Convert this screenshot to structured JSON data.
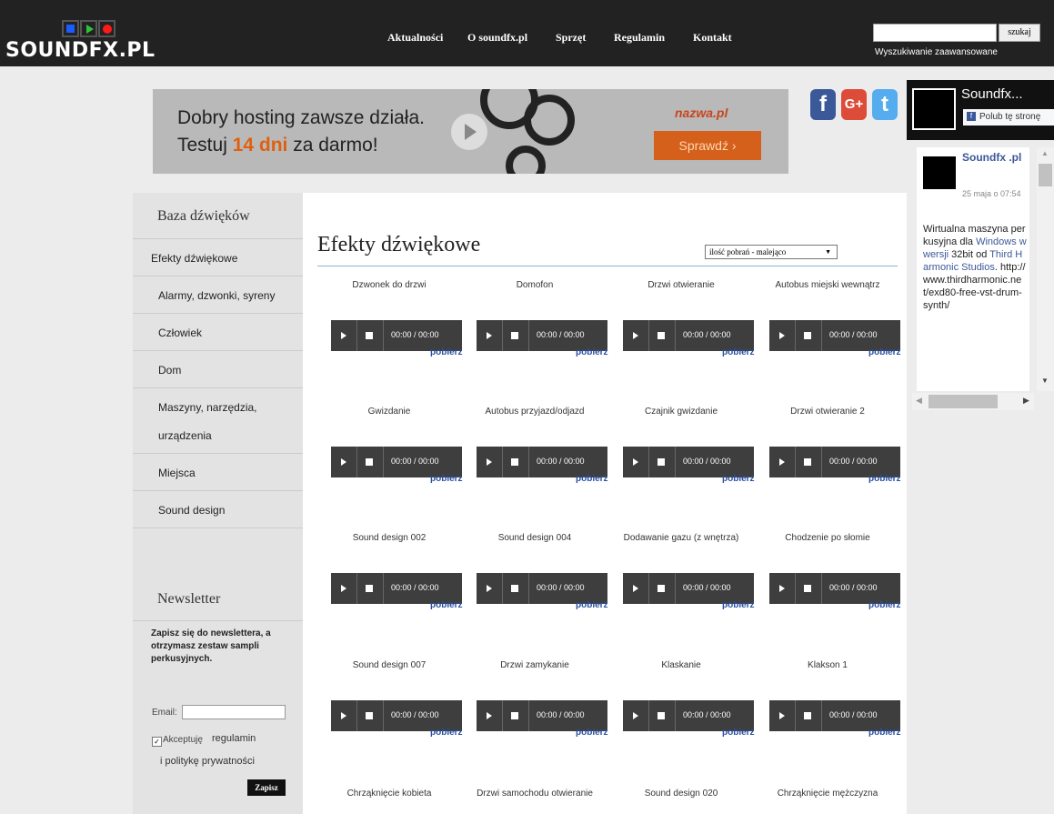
{
  "header": {
    "logo_text": "SOUNDFX.PL",
    "logo_colors": [
      "#1a5cff",
      "#2ec43a",
      "#ff1a1a"
    ],
    "nav": [
      {
        "label": "Aktualności"
      },
      {
        "label": "O soundfx.pl"
      },
      {
        "label": "Sprzęt"
      },
      {
        "label": "Regulamin"
      },
      {
        "label": "Kontakt"
      }
    ],
    "search": {
      "value": "",
      "button_label": "szukaj",
      "advanced_label": "Wyszukiwanie zaawansowane"
    }
  },
  "banner": {
    "line1": "Dobry hosting zawsze działa.",
    "line2_prefix": "Testuj ",
    "line2_highlight": "14 dni",
    "line2_suffix": " za darmo!",
    "brand": "nazwa.pl",
    "cta": "Sprawdź  ›"
  },
  "social_icons": [
    {
      "icon": "facebook-icon",
      "glyph": "f",
      "color": "#3b5998"
    },
    {
      "icon": "google-plus-icon",
      "glyph": "G+",
      "color": "#dd4b39"
    },
    {
      "icon": "twitter-icon",
      "glyph": "t",
      "color": "#55acee"
    }
  ],
  "sidebar": {
    "title": "Baza dźwięków",
    "items": [
      {
        "label": "Efekty dźwiękowe"
      },
      {
        "label": "Alarmy, dzwonki, syreny"
      },
      {
        "label": "Człowiek"
      },
      {
        "label": "Dom"
      },
      {
        "label": "Maszyny, narzędzia,"
      },
      {
        "label": "urządzenia"
      },
      {
        "label": "Miejsca"
      },
      {
        "label": "Sound design"
      }
    ]
  },
  "newsletter": {
    "title": "Newsletter",
    "description": "Zapisz się do newslettera, a otrzymasz zestaw sampli perkusyjnych.",
    "email_label": "Email:",
    "email_value": "",
    "accept_label": "Akceptuję",
    "accept_checked": true,
    "regulamin_link": "regulamin",
    "policy_link": "i politykę prywatności",
    "submit_label": "Zapisz"
  },
  "main": {
    "title": "Efekty dźwiękowe",
    "sort_value": "ilość pobrań - malejąco",
    "player_time": "00:00 / 00:00",
    "download_label": "pobierz",
    "sounds": [
      [
        "Dzwonek do drzwi",
        "Domofon",
        "Drzwi otwieranie",
        "Autobus miejski wewnątrz"
      ],
      [
        "Gwizdanie",
        "Autobus przyjazd/odjazd",
        "Czajnik gwizdanie",
        "Drzwi otwieranie 2"
      ],
      [
        "Sound design 002",
        "Sound design 004",
        "Dodawanie gazu (z wnętrza)",
        "Chodzenie po słomie"
      ],
      [
        "Sound design 007",
        "Drzwi zamykanie",
        "Klaskanie",
        "Klakson 1"
      ],
      [
        "Chrząknięcie kobieta",
        "Drzwi samochodu otwieranie",
        "Sound design 020",
        "Chrząknięcie mężczyzna"
      ]
    ]
  },
  "facebook": {
    "page_name": "Soundfx...",
    "like_label": "Polub tę stronę",
    "post_author": "Soundfx .pl",
    "post_date": "25 maja o 07:54",
    "post_text_plain": "Wirtualna maszyna perkusyjna dla ",
    "post_text_link": "Windows w wersji",
    "post_text_rest": " 32bit od ",
    "post_text_link2": "Third Harmonic Studios",
    "post_url": ". http://www.thirdharmonic.net/exd80-free-vst-drum-synth/"
  }
}
